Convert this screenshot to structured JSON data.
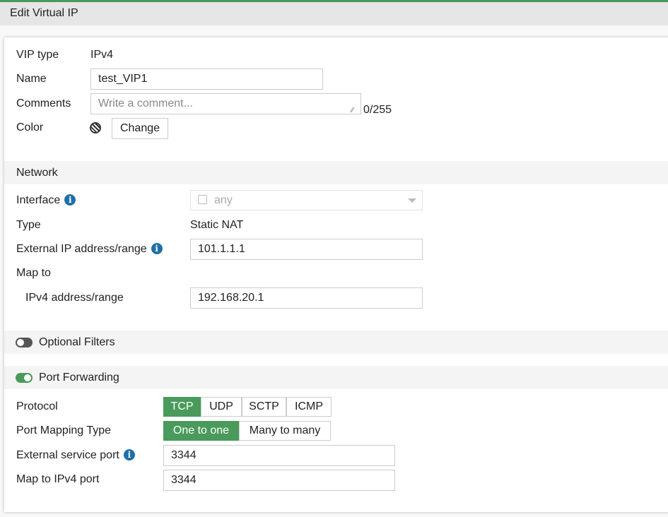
{
  "header": {
    "title": "Edit Virtual IP"
  },
  "general": {
    "vip_type_label": "VIP type",
    "vip_type_value": "IPv4",
    "name_label": "Name",
    "name_value": "test_VIP1",
    "comments_label": "Comments",
    "comments_placeholder": "Write a comment...",
    "comments_count": "0/255",
    "color_label": "Color",
    "change_label": "Change"
  },
  "network": {
    "title": "Network",
    "interface_label": "Interface",
    "interface_value": "any",
    "type_label": "Type",
    "type_value": "Static NAT",
    "external_ip_label": "External IP address/range",
    "external_ip_value": "101.1.1.1",
    "map_to_label": "Map to",
    "ipv4_label": "IPv4 address/range",
    "ipv4_value": "192.168.20.1"
  },
  "optional_filters": {
    "title": "Optional Filters",
    "enabled": false
  },
  "port_forwarding": {
    "title": "Port Forwarding",
    "enabled": true,
    "protocol_label": "Protocol",
    "protocols": [
      "TCP",
      "UDP",
      "SCTP",
      "ICMP"
    ],
    "selected_protocol": "TCP",
    "mapping_label": "Port Mapping Type",
    "mappings": [
      "One to one",
      "Many to many"
    ],
    "selected_mapping": "One to one",
    "ext_port_label": "External service port",
    "ext_port_value": "3344",
    "map_port_label": "Map to IPv4 port",
    "map_port_value": "3344"
  },
  "colors": {
    "accent": "#4a9a5b",
    "info": "#1f6fa8"
  }
}
